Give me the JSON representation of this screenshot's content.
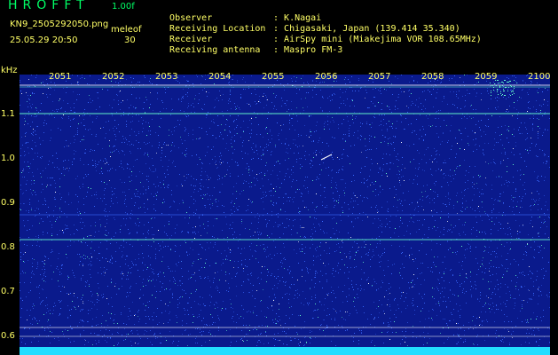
{
  "header": {
    "app_title": "HROFFT",
    "version": "1.00f",
    "filename": "KN9_2505292050.png",
    "mode": "meleof",
    "datetime": "25.05.29 20:50",
    "mode_number": "30"
  },
  "info": [
    {
      "label": "Observer",
      "value": "K.Nagai"
    },
    {
      "label": "Receiving Location",
      "value": "Chigasaki, Japan (139.414 35.340)"
    },
    {
      "label": "Receiver",
      "value": "AirSpy mini (Miakejima VOR 108.65MHz)"
    },
    {
      "label": "Receiving antenna",
      "value": "Maspro FM-3"
    }
  ],
  "separator": ":",
  "spectrogram": {
    "unit": "kHz",
    "y_ticks": [
      "1.1",
      "1.0",
      "0.9",
      "0.8",
      "0.7",
      "0.6"
    ],
    "x_ticks": [
      "2051",
      "2052",
      "2053",
      "2054",
      "2055",
      "2056",
      "2057",
      "2058",
      "2059",
      "2100"
    ],
    "colors": {
      "background": "#0a1a8c",
      "noise_light": "#3a6aff",
      "signal": "#66ffcc",
      "bright": "#ffffff",
      "bottom_band": "#22ddff"
    }
  }
}
